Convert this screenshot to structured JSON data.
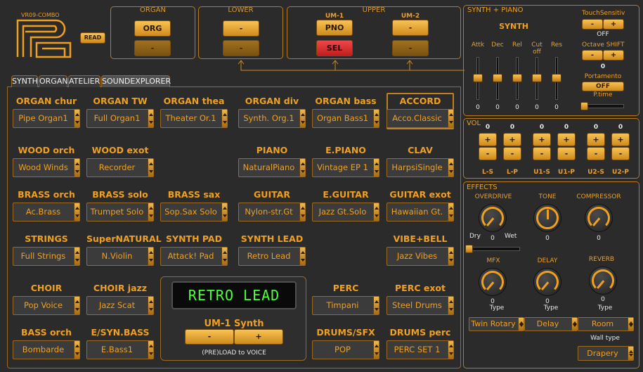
{
  "logo": {
    "title": "VR09-COMBO"
  },
  "read_button": "READ",
  "organ": {
    "title": "ORGAN",
    "btn1": "ORG",
    "btn2": "-"
  },
  "lower": {
    "title": "LOWER",
    "btn1": "-",
    "btn2": "-"
  },
  "upper": {
    "title": "UPPER",
    "um1": "UM-1",
    "um2": "UM-2",
    "btn_pno": "PNO",
    "btn_sel": "SEL",
    "btn_um2_1": "-",
    "btn_um2_2": "-"
  },
  "synth_piano": {
    "title": "SYNTH + PIANO",
    "synth_label": "SYNTH",
    "sliders": [
      {
        "label": "Attk",
        "value": "0"
      },
      {
        "label": "Dec",
        "value": "0"
      },
      {
        "label": "Rel",
        "value": "0"
      },
      {
        "label": "Cut off",
        "value": "0"
      },
      {
        "label": "Res",
        "value": "0"
      }
    ],
    "touch": {
      "label": "TouchSensitiv",
      "minus": "-",
      "plus": "+",
      "value": "OFF"
    },
    "octave": {
      "label": "Octave SHIFT",
      "minus": "-",
      "plus": "+",
      "value": "0"
    },
    "portamento": {
      "label": "Portamento",
      "button": "OFF",
      "ptime": "P.time"
    }
  },
  "vol": {
    "title": "VOL",
    "channels": [
      {
        "label": "L-S",
        "value": "0"
      },
      {
        "label": "L-P",
        "value": "0"
      },
      {
        "label": "U1-S",
        "value": "0"
      },
      {
        "label": "U1-P",
        "value": "0"
      },
      {
        "label": "U2-S",
        "value": "0"
      },
      {
        "label": "U2-P",
        "value": "0"
      }
    ],
    "plus": "+",
    "minus": "-"
  },
  "effects": {
    "title": "EFFECTS",
    "overdrive": {
      "label": "OVERDRIVE",
      "value": "0",
      "dry": "Dry",
      "wet": "Wet"
    },
    "tone": {
      "label": "TONE",
      "value": "0"
    },
    "compressor": {
      "label": "COMPRESSOR",
      "value": "0"
    },
    "mfx": {
      "label": "MFX",
      "value": "0",
      "type_label": "Type",
      "type": "Twin Rotary"
    },
    "delay": {
      "label": "DELAY",
      "value": "0",
      "type_label": "Type",
      "type": "Delay"
    },
    "reverb": {
      "label": "REVERB",
      "value": "0",
      "type_label": "Type",
      "type": "Room"
    },
    "wall": {
      "label": "Wall type",
      "type": "Drapery"
    }
  },
  "tabs": [
    "SYNTH",
    "ORGAN",
    "ATELIER",
    "SOUNDEXPLORER"
  ],
  "categories": [
    {
      "label": "ORGAN chur",
      "value": "Pipe Organ1"
    },
    {
      "label": "ORGAN TW",
      "value": "Full Organ1"
    },
    {
      "label": "ORGAN thea",
      "value": "Theater Or.1"
    },
    {
      "label": "ORGAN div",
      "value": "Synth. Org.1"
    },
    {
      "label": "ORGAN bass",
      "value": "Organ Bass1"
    },
    {
      "label": "ACCORD",
      "value": "Acco.Classic"
    },
    {
      "label": "WOOD orch",
      "value": "Wood Winds"
    },
    {
      "label": "WOOD exot",
      "value": "Recorder"
    },
    {
      "label": "PIANO",
      "value": "NaturalPiano"
    },
    {
      "label": "E.PIANO",
      "value": "Vintage EP 1"
    },
    {
      "label": "CLAV",
      "value": "HarpsiSingle"
    },
    {
      "label": "BRASS orch",
      "value": "Ac.Brass"
    },
    {
      "label": "BRASS solo",
      "value": "Trumpet Solo"
    },
    {
      "label": "BRASS sax",
      "value": "Sop.Sax Solo"
    },
    {
      "label": "GUITAR",
      "value": "Nylon-str.Gt"
    },
    {
      "label": "E.GUITAR",
      "value": "Jazz Gt.Solo"
    },
    {
      "label": "GUITAR exot",
      "value": "Hawaiian Gt."
    },
    {
      "label": "STRINGS",
      "value": "Full Strings"
    },
    {
      "label": "SuperNATURAL",
      "value": "N.Violin"
    },
    {
      "label": "SYNTH PAD",
      "value": "Attack! Pad"
    },
    {
      "label": "SYNTH LEAD",
      "value": "Retro Lead"
    },
    {
      "label": "VIBE+BELL",
      "value": "Jazz Vibes"
    },
    {
      "label": "CHOIR",
      "value": "Pop Voice"
    },
    {
      "label": "CHOIR jazz",
      "value": "Jazz Scat"
    },
    {
      "label": "PERC",
      "value": "Timpani"
    },
    {
      "label": "PERC exot",
      "value": "Steel Drums"
    },
    {
      "label": "BASS orch",
      "value": "Bombarde"
    },
    {
      "label": "E/SYN.BASS",
      "value": "E.Bass1"
    },
    {
      "label": "DRUMS/SFX",
      "value": "POP"
    },
    {
      "label": "DRUMS perc",
      "value": "PERC SET 1"
    }
  ],
  "display": {
    "text": "RETRO LEAD",
    "voice": "UM-1 Synth",
    "minus": "-",
    "plus": "+",
    "preload": "(PRE)LOAD to VOICE"
  },
  "colors": {
    "accent": "#f0a020",
    "background": "#2b2b2b",
    "lcd": "#4cff3a",
    "selected_red": "#dd3030"
  }
}
